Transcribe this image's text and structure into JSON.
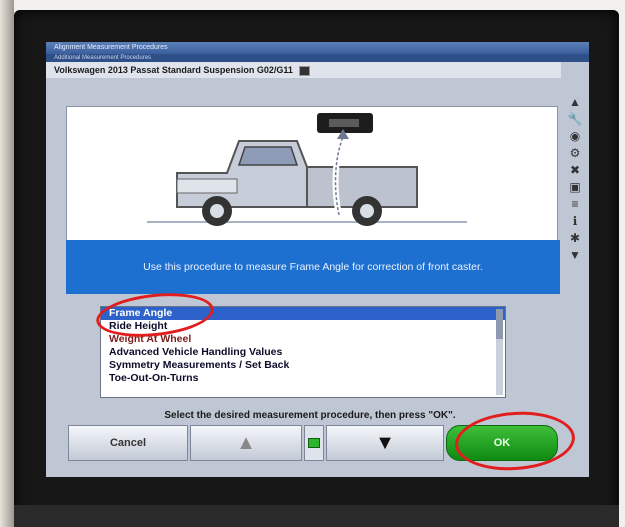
{
  "window": {
    "title": "Alignment Measurement Procedures",
    "subtitle": "Additional Measurement Procedures",
    "header": "Volkswagen 2013 Passat Standard Suspension G02/G11"
  },
  "info_text": "Use this procedure to measure Frame Angle for correction of front caster.",
  "procedures": [
    {
      "label": "Frame Angle",
      "selected": true
    },
    {
      "label": "Ride Height",
      "selected": false
    },
    {
      "label": "Weight At Wheel",
      "selected": false
    },
    {
      "label": "Advanced Vehicle Handling Values",
      "selected": false
    },
    {
      "label": "Symmetry Measurements / Set Back",
      "selected": false
    },
    {
      "label": "Toe-Out-On-Turns",
      "selected": false
    }
  ],
  "prompt": "Select the desired measurement procedure, then press \"OK\".",
  "buttons": {
    "cancel": "Cancel",
    "up": "▲",
    "down": "▼",
    "ok": "OK"
  },
  "right_toolbar_icons": [
    "scroll-up-icon",
    "wrench-icon",
    "gauge-icon",
    "tool-icon",
    "clamp-icon",
    "car-icon",
    "list-icon",
    "info-icon",
    "settings-icon",
    "scroll-down-icon"
  ],
  "colors": {
    "info_bar": "#1d6fd0",
    "selected_item": "#2c62c9",
    "ok_button": "#1aa01c",
    "annotation": "#e11d1d"
  }
}
